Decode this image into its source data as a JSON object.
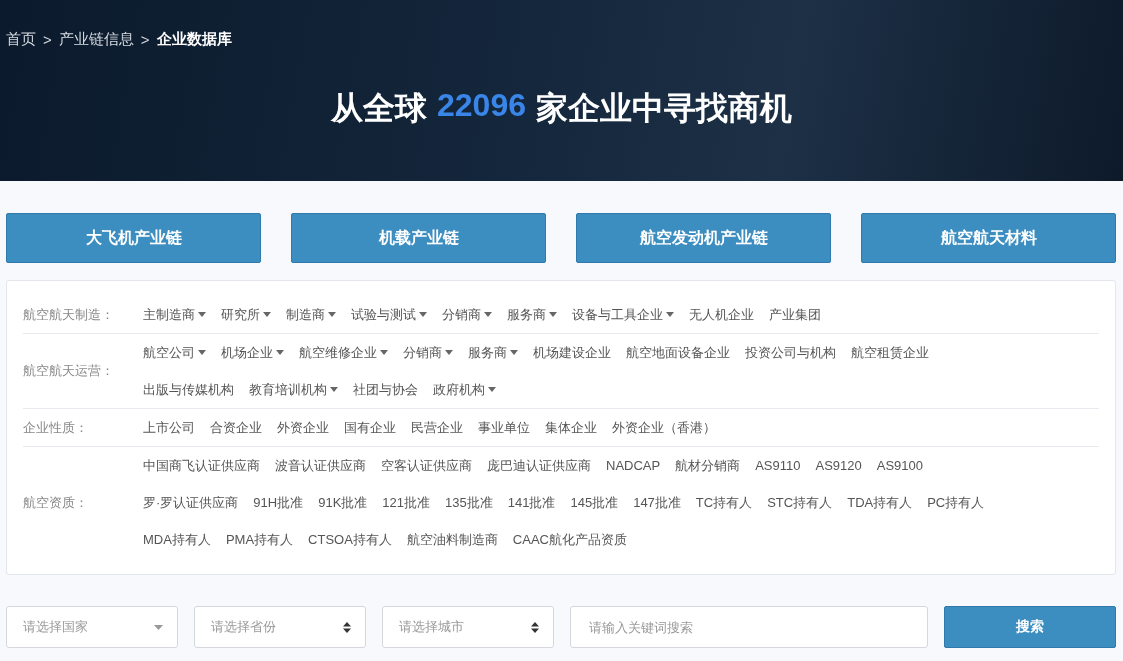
{
  "breadcrumb": {
    "separator": ">",
    "items": [
      {
        "label": "首页",
        "selected": false
      },
      {
        "label": "产业链信息",
        "selected": false
      },
      {
        "label": "企业数据库",
        "selected": true
      }
    ]
  },
  "hero": {
    "title_prefix": "从全球",
    "count": "22096",
    "title_suffix": "家企业中寻找商机"
  },
  "chain_buttons": [
    "大飞机产业链",
    "机载产业链",
    "航空发动机产业链",
    "航空航天材料"
  ],
  "filters": [
    {
      "label": "航空航天制造：",
      "lines": [
        {
          "items": [
            {
              "label": "主制造商",
              "dropdown": true
            },
            {
              "label": "研究所",
              "dropdown": true
            },
            {
              "label": "制造商",
              "dropdown": true
            },
            {
              "label": "试验与测试",
              "dropdown": true
            },
            {
              "label": "分销商",
              "dropdown": true
            },
            {
              "label": "服务商",
              "dropdown": true
            },
            {
              "label": "设备与工具企业",
              "dropdown": true
            },
            {
              "label": "无人机企业",
              "dropdown": false
            },
            {
              "label": "产业集团",
              "dropdown": false
            }
          ]
        }
      ]
    },
    {
      "label": "航空航天运营：",
      "lines": [
        {
          "items": [
            {
              "label": "航空公司",
              "dropdown": true
            },
            {
              "label": "机场企业",
              "dropdown": true
            },
            {
              "label": "航空维修企业",
              "dropdown": true
            },
            {
              "label": "分销商",
              "dropdown": true
            },
            {
              "label": "服务商",
              "dropdown": true
            },
            {
              "label": "机场建设企业",
              "dropdown": false
            },
            {
              "label": "航空地面设备企业",
              "dropdown": false
            },
            {
              "label": "投资公司与机构",
              "dropdown": false
            },
            {
              "label": "航空租赁企业",
              "dropdown": false
            }
          ]
        },
        {
          "items": [
            {
              "label": "出版与传媒机构",
              "dropdown": false
            },
            {
              "label": "教育培训机构",
              "dropdown": true
            },
            {
              "label": "社团与协会",
              "dropdown": false
            },
            {
              "label": "政府机构",
              "dropdown": true
            }
          ]
        }
      ]
    },
    {
      "label": "企业性质：",
      "lines": [
        {
          "items": [
            {
              "label": "上市公司",
              "dropdown": false
            },
            {
              "label": "合资企业",
              "dropdown": false
            },
            {
              "label": "外资企业",
              "dropdown": false
            },
            {
              "label": "国有企业",
              "dropdown": false
            },
            {
              "label": "民营企业",
              "dropdown": false
            },
            {
              "label": "事业单位",
              "dropdown": false
            },
            {
              "label": "集体企业",
              "dropdown": false
            },
            {
              "label": "外资企业（香港）",
              "dropdown": false
            }
          ]
        }
      ]
    },
    {
      "label": "航空资质：",
      "lines": [
        {
          "items": [
            {
              "label": "中国商飞认证供应商",
              "dropdown": false
            },
            {
              "label": "波音认证供应商",
              "dropdown": false
            },
            {
              "label": "空客认证供应商",
              "dropdown": false
            },
            {
              "label": "庞巴迪认证供应商",
              "dropdown": false
            },
            {
              "label": "NADCAP",
              "dropdown": false
            },
            {
              "label": "航材分销商",
              "dropdown": false
            },
            {
              "label": "AS9110",
              "dropdown": false
            },
            {
              "label": "AS9120",
              "dropdown": false
            },
            {
              "label": "AS9100",
              "dropdown": false
            }
          ]
        },
        {
          "items": [
            {
              "label": "罗·罗认证供应商",
              "dropdown": false
            },
            {
              "label": "91H批准",
              "dropdown": false
            },
            {
              "label": "91K批准",
              "dropdown": false
            },
            {
              "label": "121批准",
              "dropdown": false
            },
            {
              "label": "135批准",
              "dropdown": false
            },
            {
              "label": "141批准",
              "dropdown": false
            },
            {
              "label": "145批准",
              "dropdown": false
            },
            {
              "label": "147批准",
              "dropdown": false
            },
            {
              "label": "TC持有人",
              "dropdown": false
            },
            {
              "label": "STC持有人",
              "dropdown": false
            },
            {
              "label": "TDA持有人",
              "dropdown": false
            },
            {
              "label": "PC持有人",
              "dropdown": false
            }
          ]
        },
        {
          "items": [
            {
              "label": "MDA持有人",
              "dropdown": false
            },
            {
              "label": "PMA持有人",
              "dropdown": false
            },
            {
              "label": "CTSOA持有人",
              "dropdown": false
            },
            {
              "label": "航空油料制造商",
              "dropdown": false
            },
            {
              "label": "CAAC航化产品资质",
              "dropdown": false
            }
          ]
        }
      ]
    }
  ],
  "search": {
    "selects": [
      {
        "kind": "select",
        "placeholder": "请选择国家"
      },
      {
        "kind": "spinner",
        "placeholder": "请选择省份"
      },
      {
        "kind": "spinner",
        "placeholder": "请选择城市"
      }
    ],
    "keyword": {
      "placeholder": "请输入关键词搜索"
    },
    "button": "搜索"
  }
}
